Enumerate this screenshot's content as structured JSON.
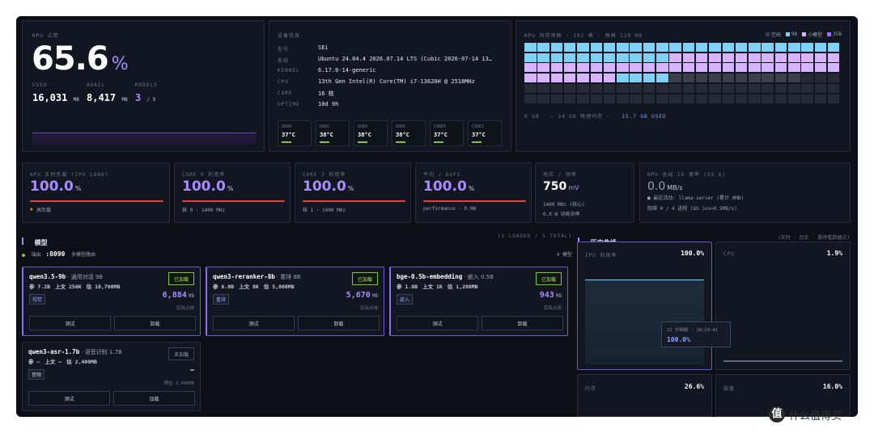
{
  "npu": {
    "title": "NPU 占用",
    "percent": "65.6",
    "unit": "%",
    "used_label": "USED",
    "used": "16,031",
    "used_unit": "MB",
    "avail_label": "AVAIL",
    "avail": "8,417",
    "avail_unit": "MB",
    "models_label": "MODELS",
    "models_loaded": "3",
    "models_total": "/ 5"
  },
  "device": {
    "title": "设备信息",
    "rows": [
      {
        "k": "型号",
        "v": "SEi"
      },
      {
        "k": "系统",
        "v": "Ubuntu 24.04.4 2026.07.14 LTS (Cubic 2026-07-14 13…"
      },
      {
        "k": "KERNEL",
        "v": "6.17.0-14-generic"
      },
      {
        "k": "CPU",
        "v": "13th Gen Intel(R) Core(TM) i7-13620H @ 2518MHz"
      },
      {
        "k": "CORE",
        "v": "16 核"
      },
      {
        "k": "UPTIME",
        "v": "10d 9h"
      }
    ],
    "temps": [
      {
        "name": "DDR0",
        "val": "37°C"
      },
      {
        "name": "DDR2",
        "val": "38°C"
      },
      {
        "name": "DDR4",
        "val": "38°C"
      },
      {
        "name": "DDR5",
        "val": "38°C"
      },
      {
        "name": "CORE0",
        "val": "37°C"
      },
      {
        "name": "CORE1",
        "val": "37°C"
      }
    ]
  },
  "memmap": {
    "title": "NPU 内存地图 · 192 格 · 每格 128 MB",
    "legend": [
      "空闲",
      "9B",
      "小模型",
      "35B"
    ],
    "legend_colors": [
      "#3b3f4a",
      "#7fd2f5",
      "#d7b4ff",
      "#9b6bff"
    ],
    "footer_left": "0 GB",
    "footer_mid": "— 24 GB 物理内存 ·",
    "footer_used": "15.7 GB USED"
  },
  "stats": [
    {
      "label": "NPU 实时负载 (IPU LOAD)",
      "value": "100.0",
      "unit": "%",
      "sub": "高负载",
      "fill": 1.0
    },
    {
      "label": "CORE 0 利用率",
      "value": "100.0",
      "unit": "%",
      "sub": "核 0 · 1400 MHz",
      "fill": 1.0
    },
    {
      "label": "CORE 1 利用率",
      "value": "100.0",
      "unit": "%",
      "sub": "核 1 · 1400 MHz",
      "fill": 1.0
    },
    {
      "label": "平均 / DVFS",
      "value": "100.0",
      "unit": "%",
      "sub": "performance · 0.0W",
      "fill": 1.0
    }
  ],
  "power": {
    "label": "电压 / 频率",
    "value": "750",
    "unit": "mV",
    "line1": "1400 MHz (核心)",
    "line2": "0.0 W 功耗功率"
  },
  "io": {
    "label": "NPU 总线 IO 速率 (SS 6)",
    "value": "0.0",
    "unit": "MB/s",
    "line1": "■ 最近活动: llama-server (累计 0MB)",
    "line2": "阻碍 0 / 4 进程 (ΔS ios=0.5MB/s)"
  },
  "models": {
    "title": "模型",
    "summary": "(3 LOADED / 5 TOTAL)",
    "port_prefix": "端出",
    "port": ":8090",
    "port_suffix": "多模型路由",
    "count": "4 模型",
    "cards": [
      {
        "name": "qwen3.5-9b",
        "desc": "· 通用对话 9B",
        "params": "参 7.2B",
        "ctx": "上文 256K",
        "mem": "估 10,700MB",
        "tag": "视觉",
        "status": "已加载",
        "used": "6,884",
        "used_unit": "MB",
        "used_label": "实际占用",
        "test": "测试",
        "unload": "卸载"
      },
      {
        "name": "qwen3-reranker-8b",
        "desc": "· 重排 8B",
        "params": "参 6.0B",
        "ctx": "上文 8K",
        "mem": "估 5,000MB",
        "tag": "重排",
        "status": "已加载",
        "used": "5,670",
        "used_unit": "MB",
        "used_label": "实际占用",
        "test": "测试",
        "unload": "卸载"
      },
      {
        "name": "bge-0.5b-embedding",
        "desc": "· 嵌入 0.5B",
        "params": "参 1.0B",
        "ctx": "上文 1K",
        "mem": "估 1,200MB",
        "tag": "嵌入",
        "status": "已加载",
        "used": "943",
        "used_unit": "MB",
        "used_label": "实际占用",
        "test": "测试",
        "unload": "卸载"
      },
      {
        "name": "qwen3-asr-1.7b",
        "desc": "· 语音识别 1.7B",
        "params": "参 —",
        "ctx": "上文 —",
        "mem": "估 2,400MB",
        "tag": "音频",
        "status": "未加载",
        "used": "—",
        "used_unit": "",
        "used_label": "预估 2,400MB",
        "test": "测试",
        "unload": "加载"
      }
    ]
  },
  "history": {
    "title": "历史曲线",
    "meta": "(实时 · 历史 · 悬停看数据点)",
    "ipu": {
      "label": "IPU 利用率",
      "value": "100.0%"
    },
    "cpu": {
      "label": "CPU",
      "value": "1.9%"
    },
    "mem": {
      "label": "内存",
      "value": "26.6%"
    },
    "disk": {
      "label": "磁盘",
      "value": "16.0%"
    },
    "tooltip": {
      "time": "12 分钟前 · 19:23:42",
      "value": "100.0%"
    }
  },
  "watermark": "什么值得买"
}
